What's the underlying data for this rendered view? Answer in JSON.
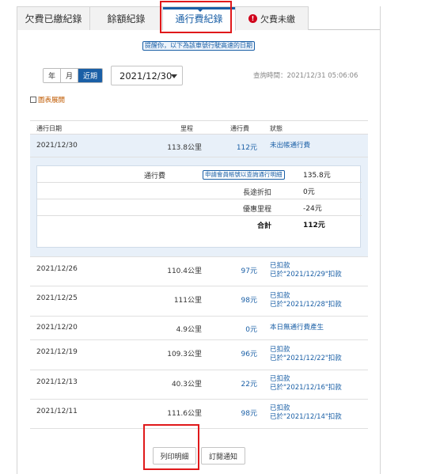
{
  "tabs": [
    {
      "label": "欠費已繳紀錄"
    },
    {
      "label": "餘額紀錄"
    },
    {
      "label": "通行費紀錄"
    },
    {
      "label": "欠費未繳"
    }
  ],
  "reminder": "提醒你，以下為該車號行駛高速的日期",
  "period_buttons": [
    "年",
    "月",
    "近期"
  ],
  "selected_date": "2021/12/30",
  "query_time": "查詢時間：2021/12/31 05:06:06",
  "chart_toggle_label": "圖表展開",
  "table": {
    "headers": {
      "date": "通行日期",
      "mileage": "里程",
      "fee": "通行費",
      "status": "狀態"
    },
    "selected_row": {
      "date": "2021/12/30",
      "mileage": "113.8公里",
      "fee": "112元",
      "status": "未出帳通行費"
    },
    "detail": {
      "fee_label": "通行費",
      "fee_link": "申請會員帳號以查詢通行明細",
      "fee_value": "135.8元",
      "discount_label": "長途折扣",
      "discount_value": "0元",
      "free_label": "優惠里程",
      "free_value": "-24元",
      "total_label": "合計",
      "total_value": "112元"
    },
    "rows": [
      {
        "date": "2021/12/26",
        "mileage": "110.4公里",
        "fee": "97元",
        "status1": "已扣款",
        "status2": "已於\"2021/12/29\"扣款"
      },
      {
        "date": "2021/12/25",
        "mileage": "111公里",
        "fee": "98元",
        "status1": "已扣款",
        "status2": "已於\"2021/12/28\"扣款"
      },
      {
        "date": "2021/12/20",
        "mileage": "4.9公里",
        "fee": "0元",
        "status1": "本日無通行費產生",
        "status2": ""
      },
      {
        "date": "2021/12/19",
        "mileage": "109.3公里",
        "fee": "96元",
        "status1": "已扣款",
        "status2": "已於\"2021/12/22\"扣款"
      },
      {
        "date": "2021/12/13",
        "mileage": "40.3公里",
        "fee": "22元",
        "status1": "已扣款",
        "status2": "已於\"2021/12/16\"扣款"
      },
      {
        "date": "2021/12/11",
        "mileage": "111.6公里",
        "fee": "98元",
        "status1": "已扣款",
        "status2": "已於\"2021/12/14\"扣款"
      }
    ]
  },
  "buttons": {
    "print": "列印明細",
    "subscribe": "訂閱通知"
  },
  "colors": {
    "accent": "#1a5fa6",
    "annotation": "#e0191b",
    "warning": "#d0021b"
  }
}
